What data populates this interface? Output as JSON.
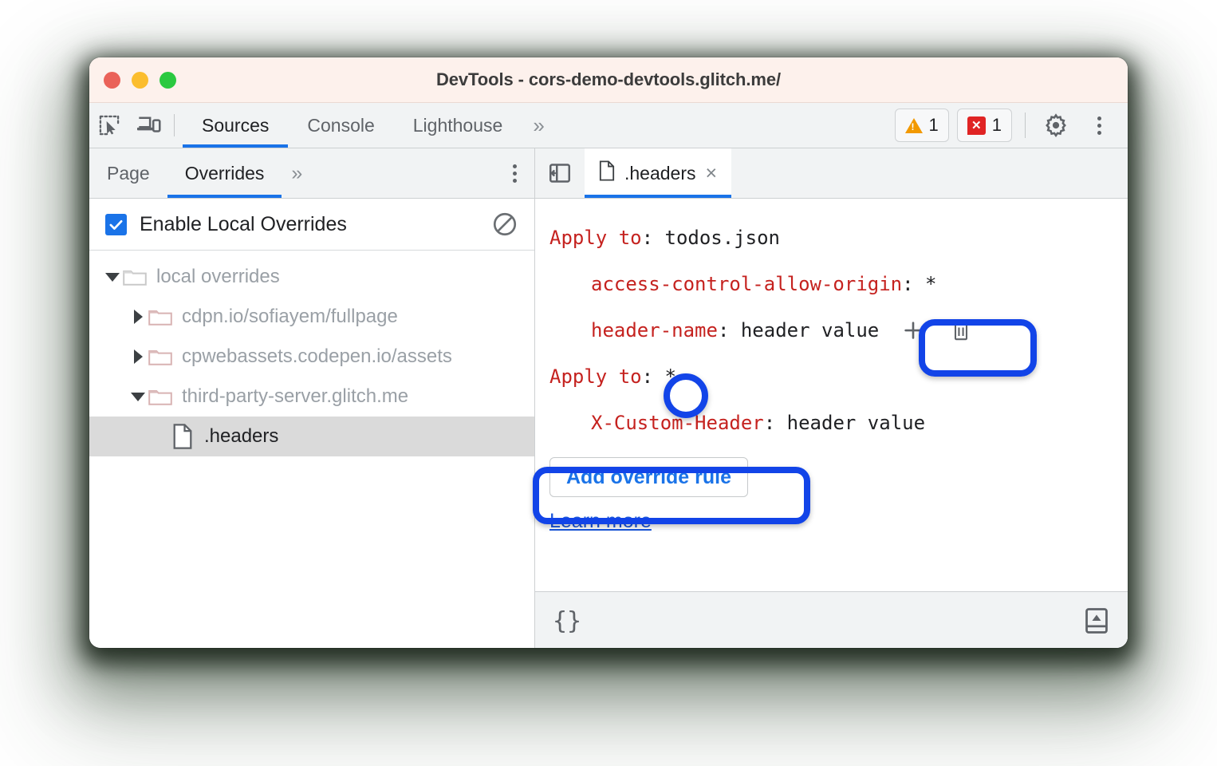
{
  "window": {
    "title": "DevTools - cors-demo-devtools.glitch.me/",
    "traffic_lights": [
      "close-red",
      "minimize-yellow",
      "maximize-green"
    ]
  },
  "toolbar": {
    "inspect_icon": "inspect-element-icon",
    "device_icon": "device-toolbar-icon",
    "tabs": [
      {
        "label": "Sources",
        "active": true
      },
      {
        "label": "Console",
        "active": false
      },
      {
        "label": "Lighthouse",
        "active": false
      }
    ],
    "more_tabs": "»",
    "warning_count": "1",
    "error_count": "1",
    "settings_icon": "gear-icon",
    "menu_icon": "kebab-menu-icon"
  },
  "sidebar": {
    "tabs": [
      {
        "label": "Page",
        "active": false
      },
      {
        "label": "Overrides",
        "active": true
      }
    ],
    "more_tabs": "»",
    "menu_icon": "kebab-menu-icon",
    "enable_overrides": {
      "label": "Enable Local Overrides",
      "checked": true,
      "clear_icon": "clear-configuration-icon"
    },
    "tree": [
      {
        "label": "local overrides",
        "type": "folder",
        "expanded": true,
        "depth": 0,
        "selected": false
      },
      {
        "label": "cdpn.io/sofiayem/fullpage",
        "type": "folder",
        "expanded": false,
        "depth": 1,
        "selected": false
      },
      {
        "label": "cpwebassets.codepen.io/assets",
        "type": "folder",
        "expanded": false,
        "depth": 1,
        "selected": false
      },
      {
        "label": "third-party-server.glitch.me",
        "type": "folder",
        "expanded": true,
        "depth": 1,
        "selected": false
      },
      {
        "label": ".headers",
        "type": "file",
        "expanded": null,
        "depth": 2,
        "selected": true
      }
    ]
  },
  "editor": {
    "collapse_icon": "collapse-sidebar-icon",
    "tab": {
      "file_icon": "file-icon",
      "label": ".headers",
      "close": "×"
    },
    "lines": [
      {
        "kind": "apply",
        "key": "Apply to",
        "sep": ": ",
        "value": "todos.json",
        "indent": false,
        "actions": false
      },
      {
        "kind": "header",
        "key": "access-control-allow-origin",
        "sep": ": ",
        "value": "*",
        "indent": true,
        "actions": false
      },
      {
        "kind": "header",
        "key": "header-name",
        "sep": ": ",
        "value": "header value",
        "indent": true,
        "actions": true
      },
      {
        "kind": "apply",
        "key": "Apply to",
        "sep": ": ",
        "value": "*",
        "indent": false,
        "actions": false
      },
      {
        "kind": "header",
        "key": "X-Custom-Header",
        "sep": ": ",
        "value": "header value",
        "indent": true,
        "actions": false
      }
    ],
    "row_actions": {
      "add": "add-header-icon",
      "delete": "delete-header-icon"
    },
    "add_rule_label": "Add override rule",
    "learn_more_label": "Learn more"
  },
  "statusbar": {
    "format_label": "{}",
    "drawer_icon": "show-drawer-icon"
  },
  "annotations": {
    "highlight_color": "#1244e8",
    "rings": [
      "row-actions-ring",
      "apply-to-value-ring",
      "add-override-rule-ring"
    ]
  },
  "colors": {
    "accent_blue": "#1a73e8",
    "header_key_red": "#c5221f",
    "titlebar_bg": "#fdf1ec",
    "toolbar_bg": "#f1f3f4",
    "warning_orange": "#f29900",
    "error_red": "#e02424",
    "selection_gray": "#dadada"
  }
}
